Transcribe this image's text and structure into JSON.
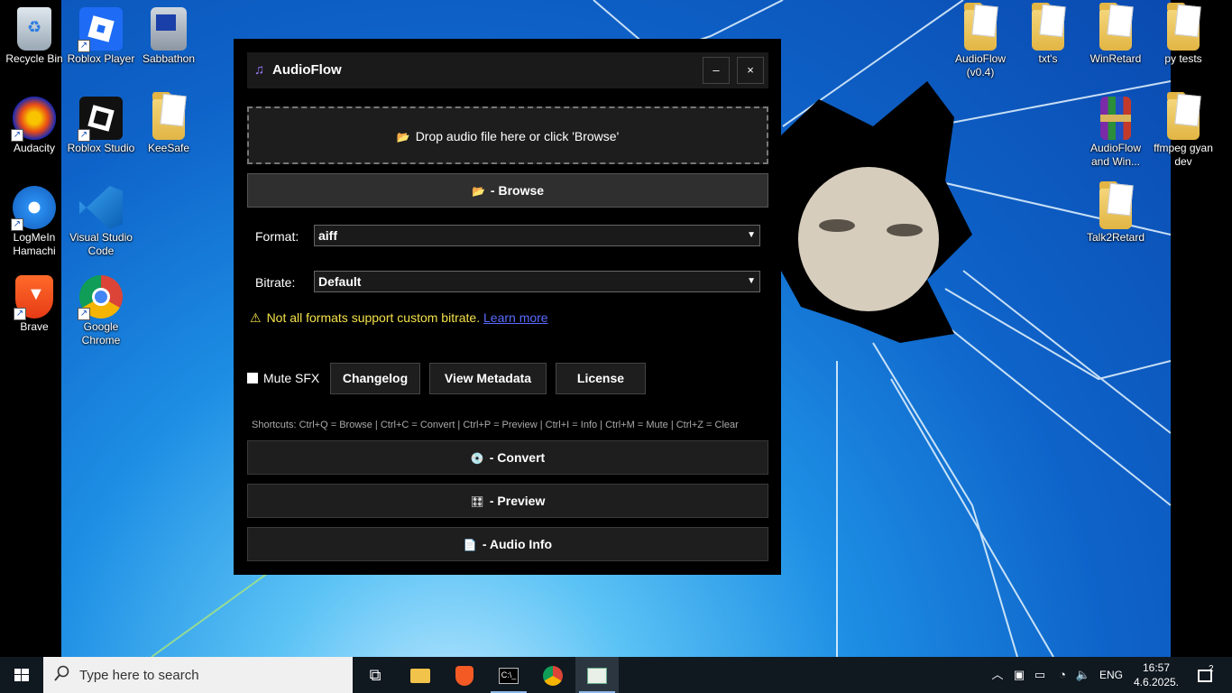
{
  "desktop_icons": [
    {
      "label": "Recycle Bin",
      "icon": "recycle-bin-icon"
    },
    {
      "label": "Roblox Player",
      "icon": "roblox-player-icon"
    },
    {
      "label": "Sabbathon",
      "icon": "sabbathon-icon"
    },
    {
      "label": "Audacity",
      "icon": "audacity-icon"
    },
    {
      "label": "Roblox Studio",
      "icon": "roblox-studio-icon"
    },
    {
      "label": "KeeSafe",
      "icon": "folder-icon"
    },
    {
      "label": "LogMeIn Hamachi",
      "icon": "hamachi-icon"
    },
    {
      "label": "Visual Studio Code",
      "icon": "vscode-icon"
    },
    {
      "label": "Brave",
      "icon": "brave-icon"
    },
    {
      "label": "Google Chrome",
      "icon": "chrome-icon"
    },
    {
      "label": "AudioFlow (v0.4)",
      "icon": "folder-icon"
    },
    {
      "label": "txt's",
      "icon": "folder-icon"
    },
    {
      "label": "WinRetard",
      "icon": "folder-icon"
    },
    {
      "label": "py tests",
      "icon": "folder-icon"
    },
    {
      "label": "AudioFlow and Win...",
      "icon": "winrar-icon"
    },
    {
      "label": "ffmpeg gyan dev",
      "icon": "folder-icon"
    },
    {
      "label": "Talk2Retard",
      "icon": "folder-icon"
    }
  ],
  "app": {
    "title": "AudioFlow",
    "title_icon": "♫",
    "minimize": "–",
    "close": "×",
    "dropzone_icon": "📂",
    "dropzone_text": "Drop audio file here or click 'Browse'",
    "browse_icon": "📂",
    "browse_label": "- Browse",
    "format_label": "Format:",
    "format_value": "aiff",
    "bitrate_label": "Bitrate:",
    "bitrate_value": "Default",
    "warning_icon": "⚠",
    "warning_text": "Not all formats support custom bitrate.",
    "learn_more": "Learn more",
    "mute_label": "Mute SFX",
    "changelog": "Changelog",
    "view_metadata": "View Metadata",
    "license": "License",
    "shortcuts": "Shortcuts: Ctrl+Q = Browse | Ctrl+C = Convert | Ctrl+P = Preview | Ctrl+I = Info | Ctrl+M = Mute | Ctrl+Z = Clear",
    "convert_icon": "💿",
    "convert_label": "- Convert",
    "preview_icon": "🎛",
    "preview_label": "- Preview",
    "info_icon": "📄",
    "info_label": "- Audio Info"
  },
  "taskbar": {
    "search_placeholder": "Type here to search",
    "language": "ENG",
    "time": "16:57",
    "date": "4.6.2025.",
    "notification_count": "2"
  }
}
